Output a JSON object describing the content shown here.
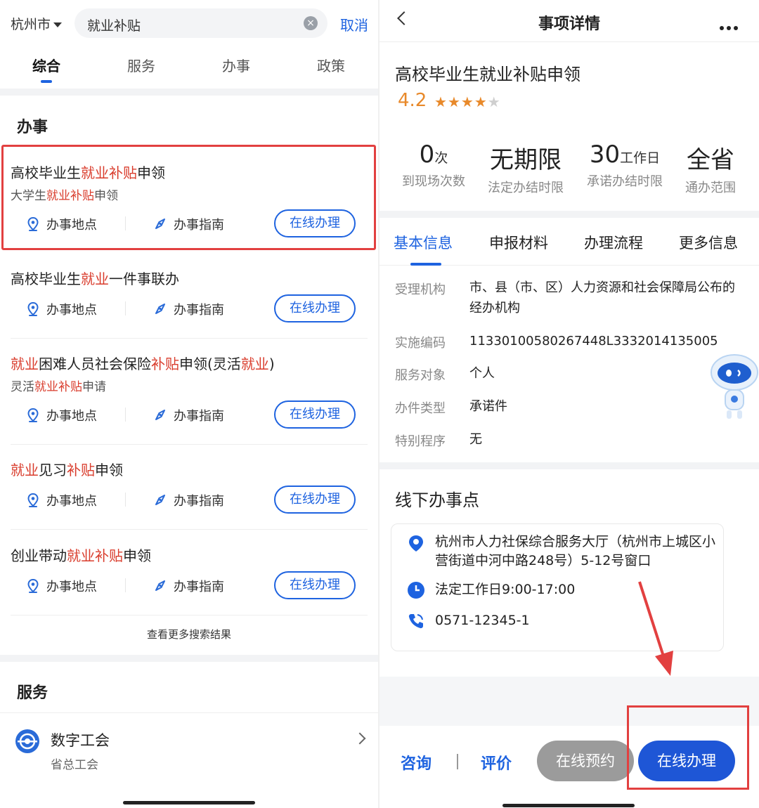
{
  "left": {
    "search": {
      "city": "杭州市",
      "query": "就业补贴",
      "cancel": "取消"
    },
    "tabs": [
      "综合",
      "服务",
      "办事",
      "政策"
    ],
    "section_affairs": "办事",
    "results": [
      {
        "title": [
          [
            "高校毕业生",
            false
          ],
          [
            "就业补贴",
            true
          ],
          [
            "申领",
            false
          ]
        ],
        "subtitle": [
          [
            "大学生",
            false
          ],
          [
            "就业补贴",
            true
          ],
          [
            "申领",
            false
          ]
        ]
      },
      {
        "title": [
          [
            "高校毕业生",
            false
          ],
          [
            "就业",
            true
          ],
          [
            "一件事联办",
            false
          ]
        ],
        "subtitle": []
      },
      {
        "title": [
          [
            "就业",
            true
          ],
          [
            "困难人员社会保险",
            false
          ],
          [
            "补贴",
            true
          ],
          [
            "申领(灵活",
            false
          ],
          [
            "就业",
            true
          ],
          [
            ")",
            false
          ]
        ],
        "subtitle": [
          [
            "灵活",
            false
          ],
          [
            "就业补贴",
            true
          ],
          [
            "申请",
            false
          ]
        ]
      },
      {
        "title": [
          [
            "就业",
            true
          ],
          [
            "见习",
            false
          ],
          [
            "补贴",
            true
          ],
          [
            "申领",
            false
          ]
        ],
        "subtitle": []
      },
      {
        "title": [
          [
            "创业带动",
            false
          ],
          [
            "就业补贴",
            true
          ],
          [
            "申领",
            false
          ]
        ],
        "subtitle": []
      }
    ],
    "actions": {
      "location": "办事地点",
      "guide": "办事指南",
      "online": "在线办理"
    },
    "more_results": "查看更多搜索结果",
    "section_services": "服务",
    "service": {
      "name": "数字工会",
      "org": "省总工会"
    }
  },
  "right": {
    "nav_title": "事项详情",
    "item_title": "高校毕业生就业补贴申领",
    "rating": "4.2",
    "rating_value": 4.2,
    "stats": [
      {
        "value": "0",
        "unit": "次",
        "label": "到现场次数"
      },
      {
        "value": "无期限",
        "unit": "",
        "label": "法定办结时限"
      },
      {
        "value": "30",
        "unit": "工作日",
        "label": "承诺办结时限"
      },
      {
        "value": "全省",
        "unit": "",
        "label": "通办范围"
      }
    ],
    "tabs": [
      "基本信息",
      "申报材料",
      "办理流程",
      "更多信息"
    ],
    "info": [
      {
        "k": "受理机构",
        "v": "市、县（市、区）人力资源和社会保障局公布的经办机构"
      },
      {
        "k": "实施编码",
        "v": "11330100580267448L3332014135005"
      },
      {
        "k": "服务对象",
        "v": "个人"
      },
      {
        "k": "办件类型",
        "v": "承诺件"
      },
      {
        "k": "特别程序",
        "v": "无"
      }
    ],
    "offline_title": "线下办事点",
    "office": {
      "address": "杭州市人力社保综合服务大厅（杭州市上城区小营街道中河中路248号）5-12号窗口",
      "hours": "法定工作日9:00-17:00",
      "phone": "0571-12345-1"
    },
    "bottom": {
      "consult": "咨询",
      "review": "评价",
      "reserve": "在线预约",
      "apply": "在线办理"
    }
  },
  "colors": {
    "accent": "#1e63e0",
    "highlight": "#d93c2c",
    "annotation": "#e24040",
    "rating": "#e8892a"
  }
}
